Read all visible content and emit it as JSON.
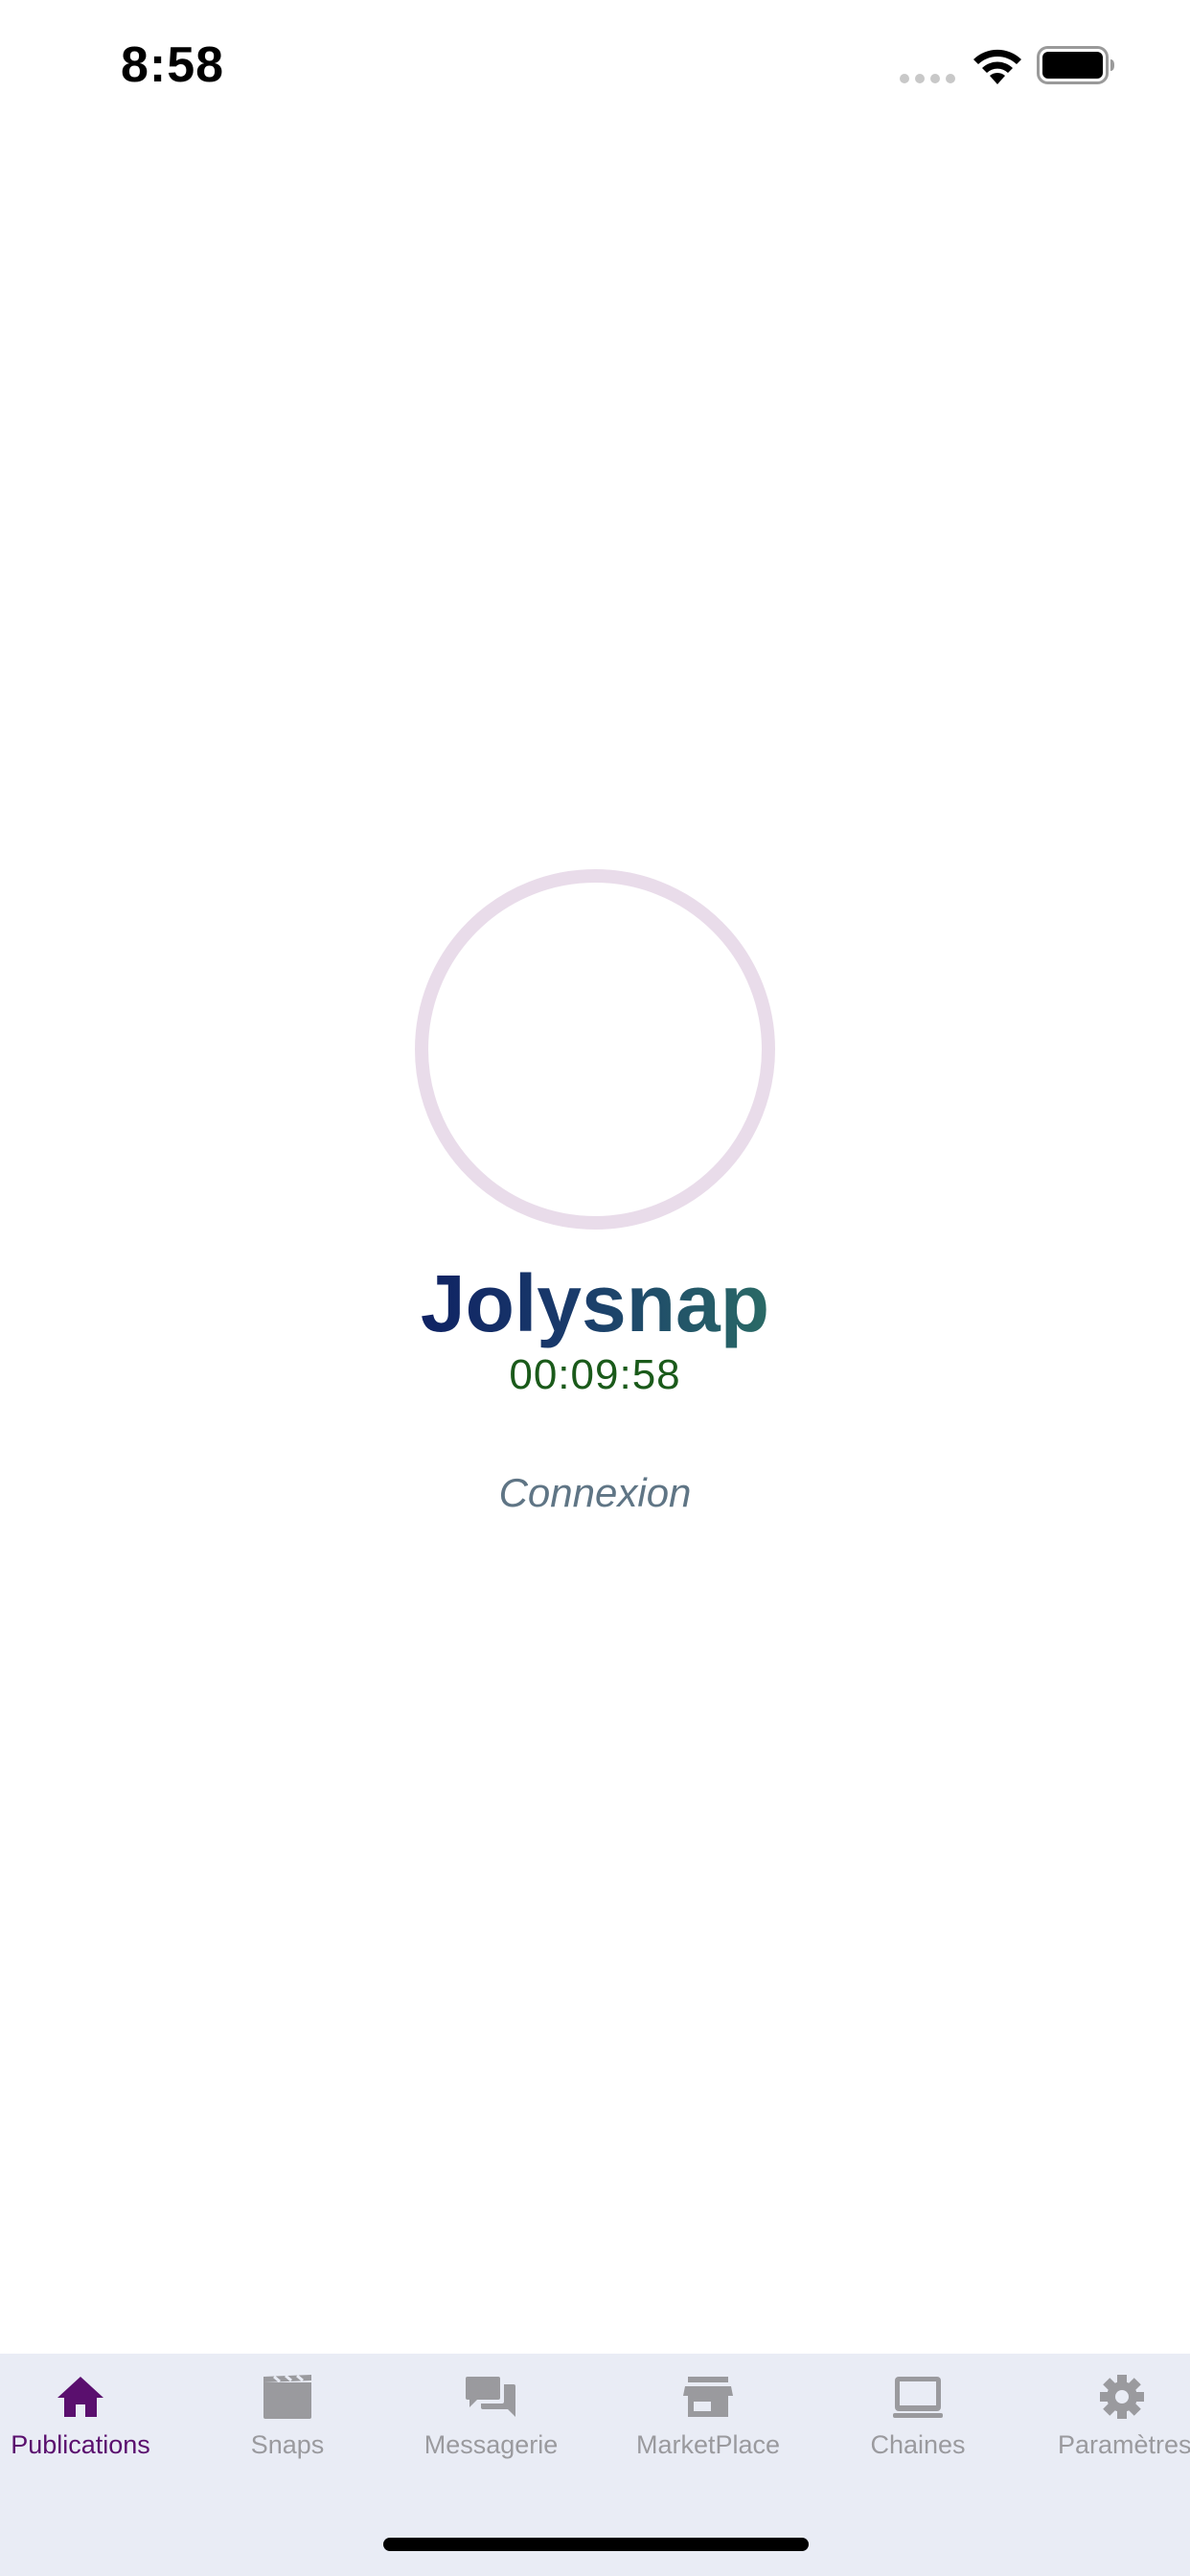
{
  "status_bar": {
    "time": "8:58"
  },
  "loader": {
    "app_name": "Jolysnap",
    "timer": "00:09:58",
    "connexion_label": "Connexion",
    "ring_color": "#e9dcea"
  },
  "tabs": [
    {
      "label": "Publications",
      "icon": "home-icon",
      "active": true
    },
    {
      "label": "Snaps",
      "icon": "clapperboard-icon",
      "active": false
    },
    {
      "label": "Messagerie",
      "icon": "chat-icon",
      "active": false
    },
    {
      "label": "MarketPlace",
      "icon": "store-icon",
      "active": false
    },
    {
      "label": "Chaines",
      "icon": "laptop-icon",
      "active": false
    },
    {
      "label": "Paramètres",
      "icon": "gear-icon",
      "active": false
    }
  ],
  "colors": {
    "active_tab": "#5a0f6e",
    "inactive_tab": "#9a9a9e",
    "tab_bar_bg": "#e9ecf5",
    "timer": "#1a5a1a",
    "connexion": "#5f7585"
  }
}
